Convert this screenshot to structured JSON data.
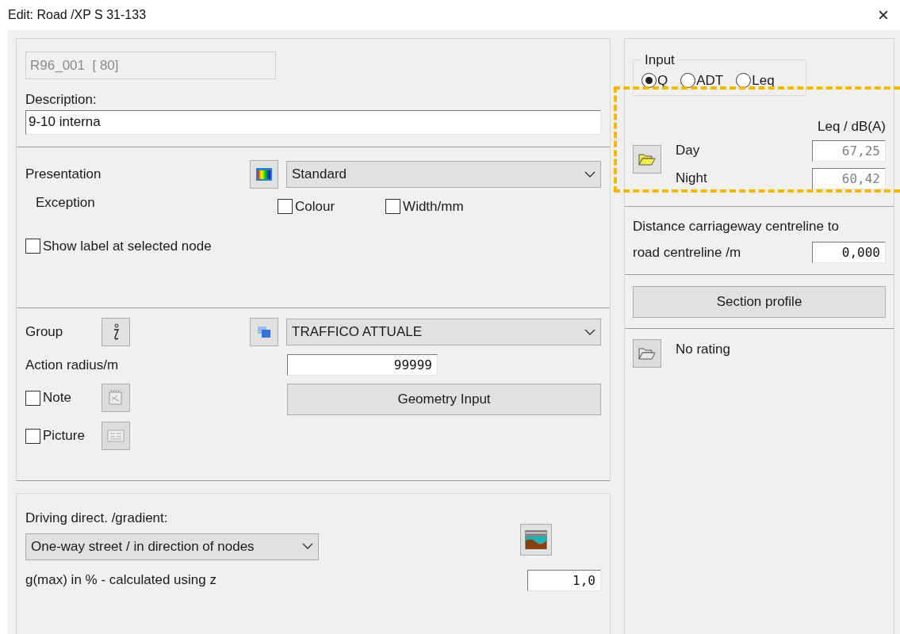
{
  "window": {
    "title": "Edit:  Road /XP S 31-133",
    "close": "×"
  },
  "identity": {
    "value": "R96_001  [ 80]",
    "disabled": true
  },
  "description": {
    "label": "Description:",
    "value": "9-10 interna"
  },
  "presentation": {
    "label": "Presentation",
    "value": "Standard",
    "exception_label": "Exception",
    "checkboxes": [
      {
        "label": "Colour",
        "checked": false
      },
      {
        "label": "Width/mm",
        "checked": false
      }
    ],
    "show_label": {
      "label": "Show label at selected node",
      "checked": false
    }
  },
  "group": {
    "label": "Group",
    "value": "TRAFFICO ATTUALE",
    "action_radius_label": "Action radius/m",
    "action_radius": "99999",
    "attachments": [
      {
        "label": "Note",
        "checked": false,
        "kind": "note"
      },
      {
        "label": "Picture",
        "checked": false,
        "kind": "picture"
      }
    ],
    "geometry_button": "Geometry Input"
  },
  "driving": {
    "label": "Driving direct. /gradient:",
    "value": "One-way street / in direction of nodes",
    "gradient_label": "g(max) in % - calculated using z",
    "gradient": "1,0"
  },
  "input": {
    "legend": "Input",
    "options": [
      {
        "label": "Q",
        "selected": true
      },
      {
        "label": "ADT",
        "selected": false
      },
      {
        "label": "Leq",
        "selected": false
      }
    ]
  },
  "levels": {
    "header": "Leq / dB(A)",
    "rows": [
      {
        "label": "Day",
        "value": "67,25",
        "disabled": true
      },
      {
        "label": "Night",
        "value": "60,42",
        "disabled": true
      }
    ]
  },
  "distance": {
    "label_lines": [
      "Distance carriageway centreline to",
      "road centreline /m"
    ],
    "value": "0,000"
  },
  "section_profile_button": "Section profile",
  "rating": {
    "label": "No rating"
  },
  "highlight": {
    "shown": true
  }
}
